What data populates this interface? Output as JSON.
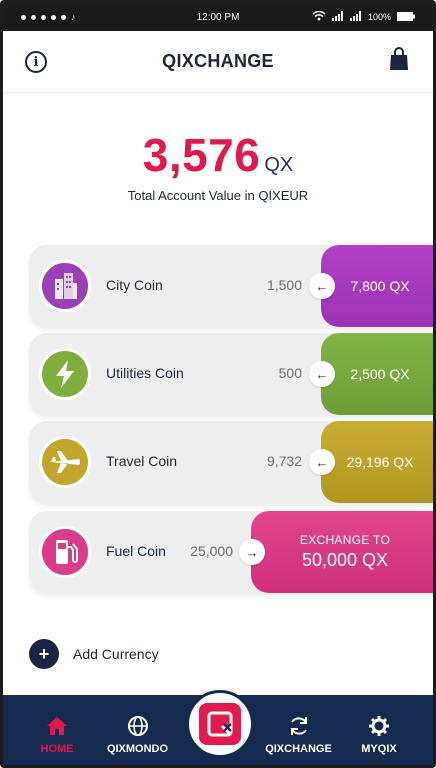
{
  "status_bar": {
    "time": "12:00 PM",
    "battery": "100%"
  },
  "header": {
    "title": "QIXCHANGE"
  },
  "total": {
    "amount": "3,576",
    "unit": "QX",
    "label": "Total Account Value in QIXEUR"
  },
  "coins": [
    {
      "name": "City Coin",
      "balance": "1,500",
      "value": "7,800 QX",
      "icon": "city-buildings-icon",
      "color": "#9a3fb6"
    },
    {
      "name": "Utilities Coin",
      "balance": "500",
      "value": "2,500 QX",
      "icon": "lightning-bolt-icon",
      "color": "#7fae3e"
    },
    {
      "name": "Travel Coin",
      "balance": "9,732",
      "value": "29,196 QX",
      "icon": "airplane-icon",
      "color": "#c1a52c"
    },
    {
      "name": "Fuel Coin",
      "balance": "25,000",
      "exchange_label": "EXCHANGE TO",
      "value": "50,000 QX",
      "icon": "fuel-pump-icon",
      "color": "#d93d85"
    }
  ],
  "add_currency": {
    "label": "Add Currency"
  },
  "nav": {
    "items": [
      {
        "label": "HOME",
        "icon": "home-icon",
        "active": true
      },
      {
        "label": "QIXMONDO",
        "icon": "globe-icon",
        "active": false
      },
      {
        "label": "QIXCHANGE",
        "icon": "refresh-icon",
        "active": false
      },
      {
        "label": "MYQIX",
        "icon": "gear-icon",
        "active": false
      }
    ],
    "center_logo": "qx-logo-icon"
  },
  "colors": {
    "accent": "#e0194e",
    "nav_bg": "#142a4f",
    "text_dark": "#1b2541"
  }
}
